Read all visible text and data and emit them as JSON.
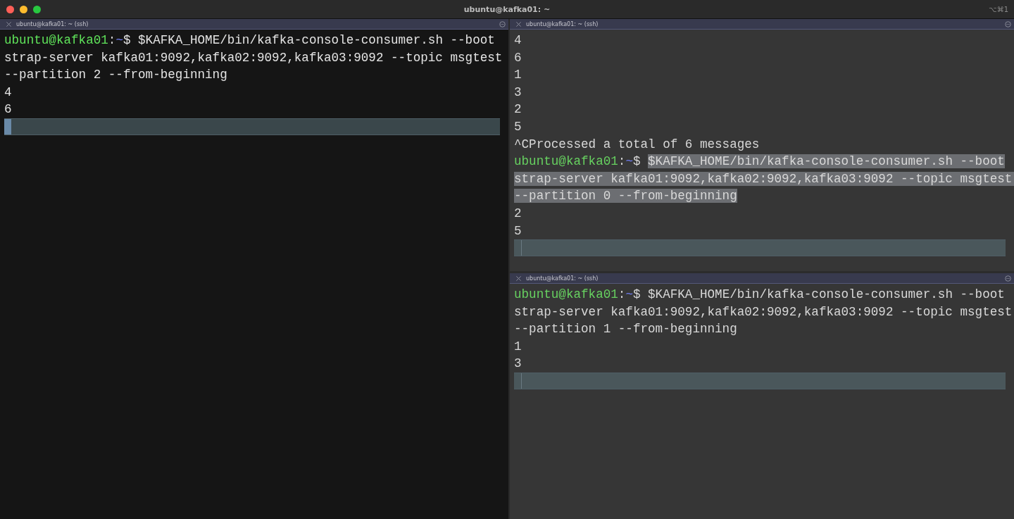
{
  "window": {
    "title": "ubuntu@kafka01: ~",
    "shortcut": "⌥⌘1"
  },
  "panes": [
    {
      "tab": "ubuntu@kafka01: ~ (ssh)",
      "active": true,
      "cursor": true,
      "lines": [
        {
          "kind": "prompt",
          "user": "ubuntu@kafka01",
          "sep": ":",
          "path": "~",
          "symbol": "$",
          "command": "$KAFKA_HOME/bin/kafka-console-consumer.sh --bootstrap-server kafka01:9092,kafka02:9092,kafka03:9092 --topic msgtest --partition 2 --from-beginning",
          "selected": false
        },
        {
          "kind": "output",
          "text": "4"
        },
        {
          "kind": "output",
          "text": "6"
        }
      ]
    },
    {
      "tab": "ubuntu@kafka01: ~ (ssh)",
      "active": false,
      "cursor": true,
      "lines": [
        {
          "kind": "output",
          "text": "4"
        },
        {
          "kind": "output",
          "text": "6"
        },
        {
          "kind": "output",
          "text": "1"
        },
        {
          "kind": "output",
          "text": "3"
        },
        {
          "kind": "output",
          "text": "2"
        },
        {
          "kind": "output",
          "text": "5"
        },
        {
          "kind": "output",
          "text": "^CProcessed a total of 6 messages"
        },
        {
          "kind": "prompt",
          "user": "ubuntu@kafka01",
          "sep": ":",
          "path": "~",
          "symbol": "$",
          "command": "$KAFKA_HOME/bin/kafka-console-consumer.sh --bootstrap-server kafka01:9092,kafka02:9092,kafka03:9092 --topic msgtest --partition 0 --from-beginning",
          "selected": true
        },
        {
          "kind": "output",
          "text": "2"
        },
        {
          "kind": "output",
          "text": "5"
        }
      ]
    },
    {
      "tab": "ubuntu@kafka01: ~ (ssh)",
      "active": false,
      "cursor": true,
      "lines": [
        {
          "kind": "prompt",
          "user": "ubuntu@kafka01",
          "sep": ":",
          "path": "~",
          "symbol": "$",
          "command": "$KAFKA_HOME/bin/kafka-console-consumer.sh --bootstrap-server kafka01:9092,kafka02:9092,kafka03:9092 --topic msgtest --partition 1 --from-beginning",
          "selected": false
        },
        {
          "kind": "output",
          "text": "1"
        },
        {
          "kind": "output",
          "text": "3"
        }
      ]
    }
  ]
}
